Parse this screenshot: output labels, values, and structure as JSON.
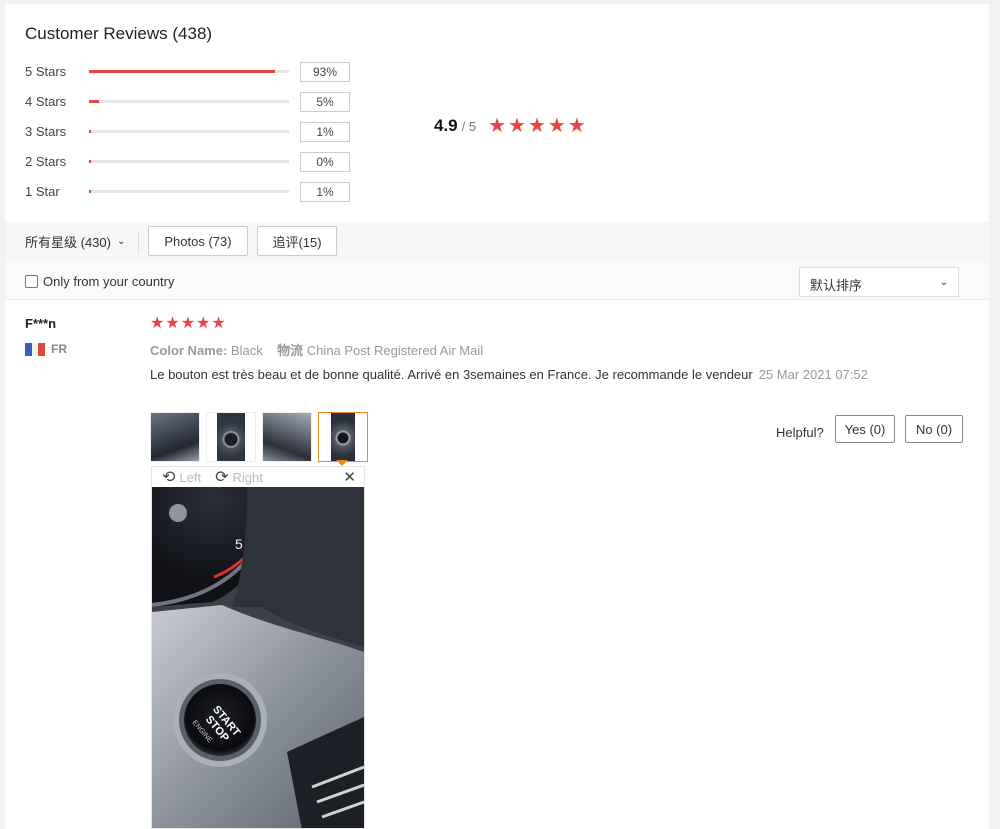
{
  "header": {
    "title": "Customer Reviews (438)"
  },
  "distribution": [
    {
      "label": "5 Stars",
      "percent": 93,
      "percent_text": "93%"
    },
    {
      "label": "4 Stars",
      "percent": 5,
      "percent_text": "5%"
    },
    {
      "label": "3 Stars",
      "percent": 1,
      "percent_text": "1%"
    },
    {
      "label": "2 Stars",
      "percent": 0,
      "percent_text": "0%"
    },
    {
      "label": "1 Star",
      "percent": 1,
      "percent_text": "1%"
    }
  ],
  "average": {
    "value": "4.9",
    "out_of": "/ 5",
    "stars": 5
  },
  "filters": {
    "rating_select": "所有星级 (430)",
    "photos_chip": "Photos (73)",
    "followup_chip": "追评(15)",
    "only_country": "Only from your country",
    "only_country_checked": false,
    "sort_label": "默认排序"
  },
  "review": {
    "name": "F***n",
    "country_code": "FR",
    "rating": 5,
    "color_label": "Color Name:",
    "color_value": "Black",
    "logistics_label": "物流",
    "logistics_value": "China Post Registered Air Mail",
    "text": "Le bouton est très beau et de bonne qualité. Arrivé en 3semaines en France. Je recommande le vendeur",
    "date": "25 Mar 2021 07:52",
    "helpful_label": "Helpful?",
    "yes_label": "Yes (0)",
    "no_label": "No (0)",
    "thumb_count": 4,
    "active_thumb": 4
  },
  "viewer": {
    "rotate_left_label": "Left",
    "rotate_right_label": "Right",
    "close_icon": "close-icon"
  },
  "colors": {
    "accent": "#e64545",
    "active_border": "#e88a22"
  }
}
